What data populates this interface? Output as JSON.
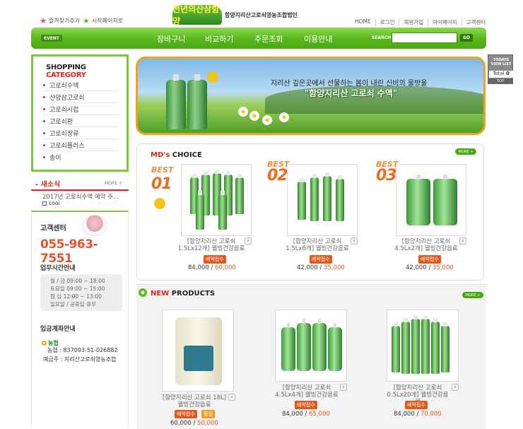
{
  "top": {
    "bookmark": "즐겨찾기추가",
    "startpage": "시작페이지로",
    "logo_mark": "천년의산삼함양",
    "logo_text": "함양지리산고로쇠영농조합법인",
    "links": [
      "HOME",
      "로그인",
      "회원가입",
      "마이페이지",
      "고객센터"
    ]
  },
  "nav": {
    "event": "EVENT",
    "items": [
      "장바구니",
      "비교하기",
      "주문조회",
      "이용안내"
    ],
    "search_label": "SEARCH",
    "search_value": "",
    "go": "GO"
  },
  "category": {
    "title_a": "SHOPPING ",
    "title_b": "CATEGORY",
    "items": [
      "고로쇠수액",
      "산양삼고로쇠",
      "고로쇠시럽",
      "고로쇠환",
      "고로쇠장류",
      "고로쇠플러스",
      "송이"
    ]
  },
  "news": {
    "title": "- 새소식",
    "more": "MORE +",
    "item": "2017년 고로쇠수액 예약 주...",
    "user": "cool"
  },
  "cs": {
    "title": "고객센터",
    "phone": "055-963-7551",
    "hours_title": "업무시간안내",
    "hours": [
      "월 / 금  09:00 ~ 18:00",
      "토요일  09:00 ~ 15:00",
      "점  심  12:00 ~ 13:00",
      "일요일 / 공휴일 휴무"
    ],
    "account_title": "입금계좌안내",
    "bank_logo": "농협",
    "account_no": "농협 : 837093-51-026882",
    "account_name": "예금주 : 지리산고로쇠영농조합"
  },
  "banner": {
    "line1": "지리산 깊은곳에서 선물하는 봄이 내린 신비의 물방울",
    "line2": "\"함양지리산 고로쇠 수액\""
  },
  "today": {
    "title": "TODAYS VIEW LIST",
    "total_label": "Total ",
    "total": "0",
    "top": "TOP"
  },
  "md": {
    "title_a": "MD's ",
    "title_b": "CHOICE",
    "more": "MORE +",
    "products": [
      {
        "best": "BEST",
        "rank": "01",
        "name": "[함양지리산 고로쇠 1.5Lx12개] 웰빙건강음료",
        "tag": "예약접수",
        "price": "84,000",
        "sale": "60,000"
      },
      {
        "best": "BEST",
        "rank": "02",
        "name": "[함양지리산 고로쇠 1.5Lx6개] 웰빙건강음료",
        "tag": "예약접수",
        "price": "42,000",
        "sale": "35,000"
      },
      {
        "best": "BEST",
        "rank": "03",
        "name": "[함양지리산 고로쇠 4.5Lx2개] 웰빙건강음료",
        "tag": "예약접수",
        "price": "42,000",
        "sale": "35,000"
      }
    ]
  },
  "new": {
    "title_a": "NEW ",
    "title_b": "PRODUCTS",
    "more": "MORE +",
    "products": [
      {
        "name": "[함양지리산 고로쇠 18L] 웰빙건강음료",
        "tag": "예약접수",
        "tag2": "품절",
        "price": "60,000",
        "sale": "50,000"
      },
      {
        "name": "[함양지리산 고로쇠 4.5Lx4개] 웰빙건강음료",
        "tag": "예약접수",
        "price": "84,000",
        "sale": "65,000"
      },
      {
        "name": "[함양지리산 고로쇠 0.5Lx20개] 웰빙건강음료",
        "tag": "예약접수",
        "price": "84,000",
        "sale": "70,000"
      }
    ]
  },
  "colors": {
    "green": "#5cb91e",
    "orange": "#f0a21a",
    "red": "#e0251b"
  }
}
